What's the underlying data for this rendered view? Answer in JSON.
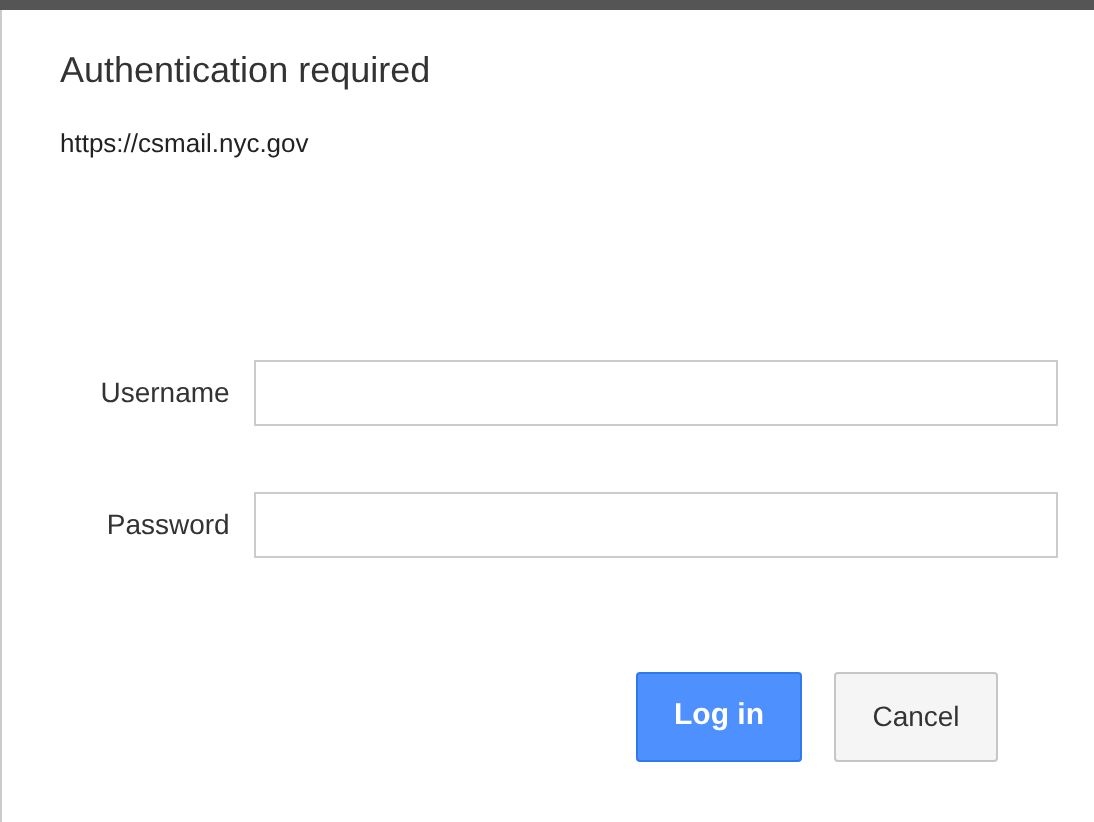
{
  "dialog": {
    "title": "Authentication required",
    "origin": "https://csmail.nyc.gov"
  },
  "fields": [
    {
      "label": "Username"
    },
    {
      "label": "Password"
    }
  ],
  "buttons": [
    {
      "label": "Log in",
      "kind": "primary"
    },
    {
      "label": "Cancel",
      "kind": "secondary"
    }
  ]
}
